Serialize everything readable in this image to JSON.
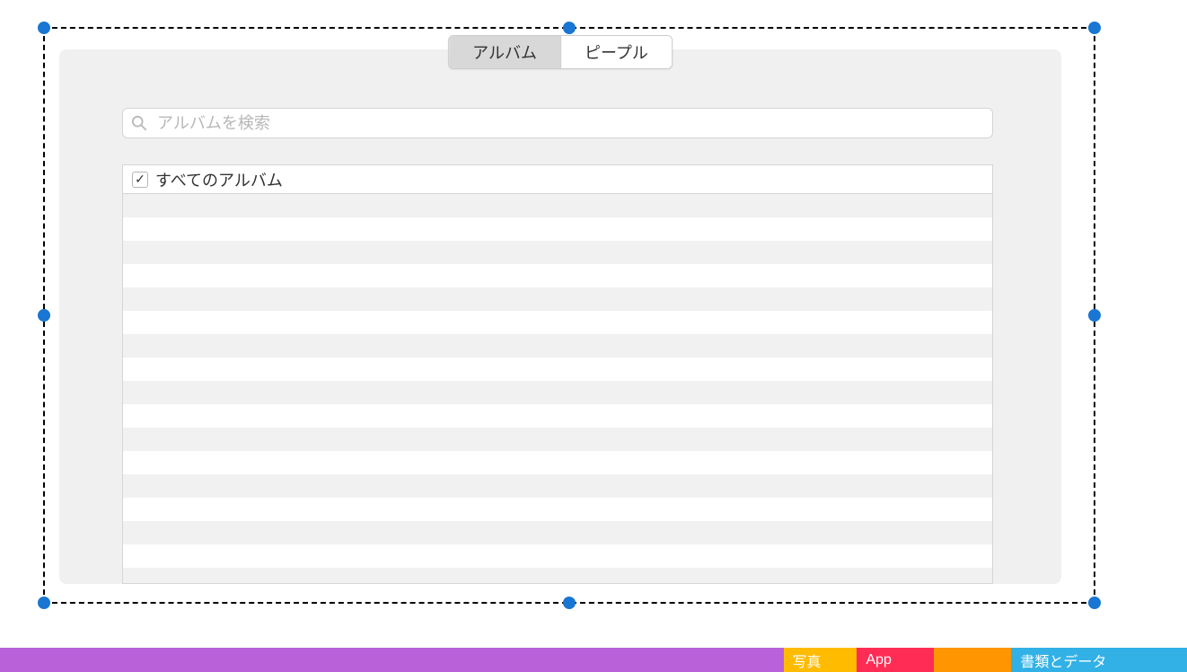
{
  "tabs": {
    "album": "アルバム",
    "people": "ピープル"
  },
  "search": {
    "placeholder": "アルバムを検索",
    "value": ""
  },
  "list": {
    "header_label": "すべてのアルバム",
    "checked": true
  },
  "storage": {
    "segments": [
      {
        "label": "",
        "color": "purple",
        "width": "66%"
      },
      {
        "label": "写真",
        "color": "yellow",
        "width": "6.2%"
      },
      {
        "label": "App",
        "color": "red",
        "width": "6.5%"
      },
      {
        "label": "",
        "color": "orange",
        "width": "6.5%"
      },
      {
        "label": "書類とデータ",
        "color": "blue",
        "width": "14.8%"
      }
    ]
  }
}
